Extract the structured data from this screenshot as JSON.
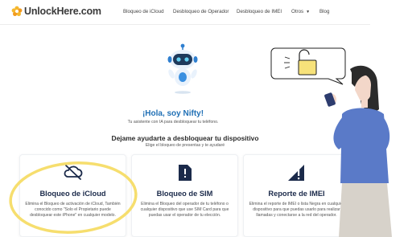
{
  "header": {
    "logo_text": "UnlockHere.com",
    "nav": [
      {
        "label": "Bloqueo de iCloud"
      },
      {
        "label": "Desbloqueo de Operador"
      },
      {
        "label": "Desbloqueo de IMEI"
      },
      {
        "label": "Otros"
      },
      {
        "label": "Blog"
      }
    ]
  },
  "hero": {
    "title": "¡Hola, soy Nifty!",
    "subtitle": "Tu asistente con IA para desbloquear tu teléfono.",
    "help_title": "Dejame ayudarte a desbloquear tu dispositivo",
    "help_subtitle": "Elige el bloqueo de presentas y te ayudaré"
  },
  "cards": [
    {
      "title": "Bloqueo de iCloud",
      "description": "Elimina el Bloqueo de activación de iCloud, También conocido como \"Solo el Propietario puede desbloquear este iPhone\" en cualquier modelo.",
      "icon": "cloud-off-icon"
    },
    {
      "title": "Bloqueo de SIM",
      "description": "Elimina el Bloqueo del operador de tu teléfono o cualquier dispositivo que use SIM Card para que puedas usar el operador de tu elección.",
      "icon": "sim-card-icon"
    },
    {
      "title": "Reporte de IMEI",
      "description": "Elimina el reporte de IMEI o lista Negra en cualquier dispositivo para que puedas usarlo para realizar llamadas y conectarse a la red del operador.",
      "icon": "signal-alert-icon"
    }
  ],
  "colors": {
    "brand_blue": "#1f6fb5",
    "navy": "#1b2a4a",
    "highlight_yellow": "#f6de6e",
    "lock_yellow": "#f7e27a",
    "sweater_blue": "#5a7ac8"
  }
}
